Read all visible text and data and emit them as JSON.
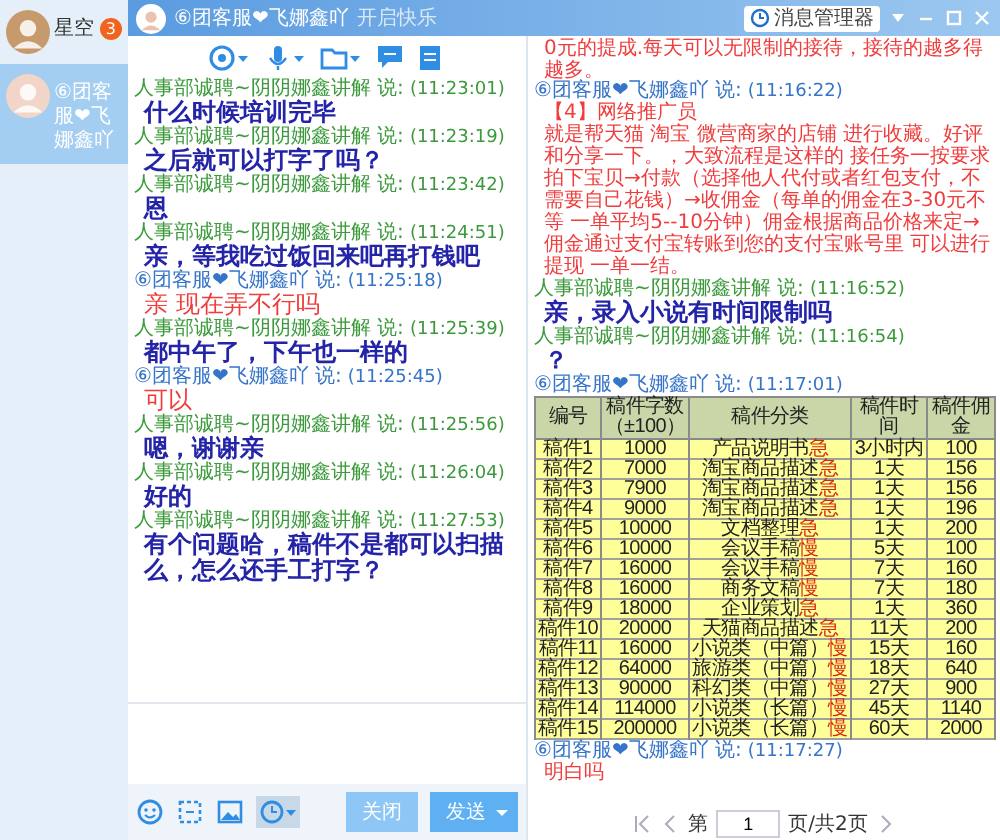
{
  "sidebar": [
    {
      "name": "星空",
      "badge": "3",
      "selected": false
    },
    {
      "name": "⑥团客服❤飞娜鑫吖",
      "selected": true
    }
  ],
  "window": {
    "title": "⑥团客服❤飞娜鑫吖",
    "tagline": "开启快乐",
    "manager": "消息管理器"
  },
  "conversation": [
    {
      "kind": "them",
      "sender": "人事部诚聘~阴阴娜鑫讲解 说:",
      "time": "(11:23:01)",
      "paragraphs": [
        "什么时候培训完毕"
      ]
    },
    {
      "kind": "them",
      "sender": "人事部诚聘~阴阴娜鑫讲解 说:",
      "time": "(11:23:19)",
      "paragraphs": [
        "之后就可以打字了吗？"
      ]
    },
    {
      "kind": "them",
      "sender": "人事部诚聘~阴阴娜鑫讲解 说:",
      "time": "(11:23:42)",
      "paragraphs": [
        "恩"
      ]
    },
    {
      "kind": "them",
      "sender": "人事部诚聘~阴阴娜鑫讲解 说:",
      "time": "(11:24:51)",
      "paragraphs": [
        "亲，等我吃过饭回来吧再打钱吧"
      ]
    },
    {
      "kind": "me",
      "sender": "⑥团客服❤飞娜鑫吖 说:",
      "time": "(11:25:18)",
      "paragraphs": [
        "亲 现在弄不行吗"
      ]
    },
    {
      "kind": "them",
      "sender": "人事部诚聘~阴阴娜鑫讲解 说:",
      "time": "(11:25:39)",
      "paragraphs": [
        "都中午了，下午也一样的"
      ]
    },
    {
      "kind": "me",
      "sender": "⑥团客服❤飞娜鑫吖 说:",
      "time": "(11:25:45)",
      "paragraphs": [
        "可以"
      ]
    },
    {
      "kind": "them",
      "sender": "人事部诚聘~阴阴娜鑫讲解 说:",
      "time": "(11:25:56)",
      "paragraphs": [
        "嗯，谢谢亲"
      ]
    },
    {
      "kind": "them",
      "sender": "人事部诚聘~阴阴娜鑫讲解 说:",
      "time": "(11:26:04)",
      "paragraphs": [
        "好的"
      ]
    },
    {
      "kind": "them",
      "sender": "人事部诚聘~阴阴娜鑫讲解 说:",
      "time": "(11:27:53)",
      "paragraphs": [
        "有个问题哈，稿件不是都可以扫描么，怎么还手工打字？"
      ]
    }
  ],
  "buttons": {
    "close": "关闭",
    "send": "发送"
  },
  "history": {
    "earlier_text": "0元的提成.每天可以无限制的接待，接待的越多得越多。",
    "messages": [
      {
        "kind": "me",
        "sender": "⑥团客服❤飞娜鑫吖 说:",
        "time": "(11:16:22)",
        "paragraphs": [
          "【4】网络推广员",
          "就是帮天猫 淘宝 微营商家的店铺 进行收藏。好评和分享一下。，大致流程是这样的 接任务一按要求拍下宝贝→付款（选择他人代付或者红包支付，不需要自己花钱）→收佣金（每单的佣金在3-30元不等 一单平均5--10分钟）佣金根据商品价格来定→佣金通过支付宝转账到您的支付宝账号里 可以进行提现 一单一结。"
        ]
      },
      {
        "kind": "them",
        "sender": "人事部诚聘~阴阴娜鑫讲解 说:",
        "time": "(11:16:52)",
        "paragraphs": [
          "亲，录入小说有时间限制吗"
        ]
      },
      {
        "kind": "them",
        "sender": "人事部诚聘~阴阴娜鑫讲解 说:",
        "time": "(11:16:54)",
        "paragraphs": [
          "？"
        ]
      },
      {
        "kind": "me",
        "sender": "⑥团客服❤飞娜鑫吖 说:",
        "time": "(11:17:01)",
        "table": {
          "columns": [
            "编号",
            "稿件字数（±100）",
            "稿件分类",
            "稿件时间",
            "稿件佣金"
          ],
          "rows": [
            {
              "cells": [
                "稿件1",
                "1000",
                "产品说明书",
                "3小时内",
                "100"
              ],
              "tag": "急"
            },
            {
              "cells": [
                "稿件2",
                "7000",
                "淘宝商品描述",
                "1天",
                "156"
              ],
              "tag": "急"
            },
            {
              "cells": [
                "稿件3",
                "7900",
                "淘宝商品描述",
                "1天",
                "156"
              ],
              "tag": "急"
            },
            {
              "cells": [
                "稿件4",
                "9000",
                "淘宝商品描述",
                "1天",
                "196"
              ],
              "tag": "急"
            },
            {
              "cells": [
                "稿件5",
                "10000",
                "文档整理",
                "1天",
                "200"
              ],
              "tag": "急"
            },
            {
              "cells": [
                "稿件6",
                "10000",
                "会议手稿",
                "5天",
                "100"
              ],
              "tag": "慢"
            },
            {
              "cells": [
                "稿件7",
                "16000",
                "会议手稿",
                "7天",
                "160"
              ],
              "tag": "慢"
            },
            {
              "cells": [
                "稿件8",
                "16000",
                "商务文稿",
                "7天",
                "180"
              ],
              "tag": "慢"
            },
            {
              "cells": [
                "稿件9",
                "18000",
                "企业策划",
                "1天",
                "360"
              ],
              "tag": "急"
            },
            {
              "cells": [
                "稿件10",
                "20000",
                "天猫商品描述",
                "11天",
                "200"
              ],
              "tag": "急"
            },
            {
              "cells": [
                "稿件11",
                "16000",
                "小说类（中篇）",
                "15天",
                "160"
              ],
              "tag": "慢"
            },
            {
              "cells": [
                "稿件12",
                "64000",
                "旅游类（中篇）",
                "18天",
                "640"
              ],
              "tag": "慢"
            },
            {
              "cells": [
                "稿件13",
                "90000",
                "科幻类（中篇）",
                "27天",
                "900"
              ],
              "tag": "慢"
            },
            {
              "cells": [
                "稿件14",
                "114000",
                "小说类（长篇）",
                "45天",
                "1140"
              ],
              "tag": "慢"
            },
            {
              "cells": [
                "稿件15",
                "200000",
                "小说类（长篇）",
                "60天",
                "2000"
              ],
              "tag": "慢"
            }
          ]
        }
      },
      {
        "kind": "me",
        "sender": "⑥团客服❤飞娜鑫吖 说:",
        "time": "(11:17:27)",
        "paragraphs": [
          "明白吗"
        ]
      }
    ],
    "pager": {
      "prefix": "第",
      "page": "1",
      "suffix": "页/共2页"
    }
  }
}
